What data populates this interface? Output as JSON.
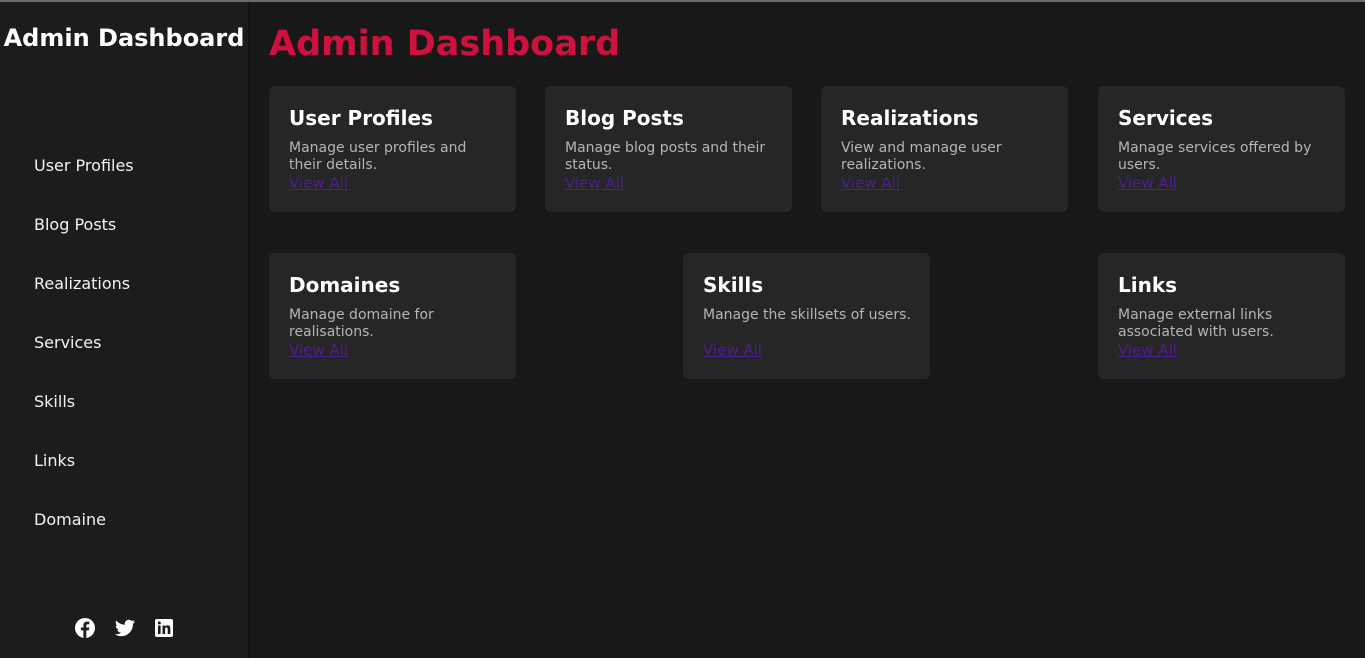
{
  "sidebar": {
    "title": "Admin Dashboard",
    "items": [
      {
        "label": "User Profiles"
      },
      {
        "label": "Blog Posts"
      },
      {
        "label": "Realizations"
      },
      {
        "label": "Services"
      },
      {
        "label": "Skills"
      },
      {
        "label": "Links"
      },
      {
        "label": "Domaine"
      }
    ],
    "social": [
      "facebook-icon",
      "twitter-icon",
      "linkedin-icon"
    ]
  },
  "main": {
    "title": "Admin Dashboard",
    "cards": [
      {
        "title": "User Profiles",
        "description": "Manage user profiles and their details.",
        "link": "View All"
      },
      {
        "title": "Blog Posts",
        "description": "Manage blog posts and their status.",
        "link": "View All"
      },
      {
        "title": "Realizations",
        "description": "View and manage user realizations.",
        "link": "View All"
      },
      {
        "title": "Services",
        "description": "Manage services offered by users.",
        "link": "View All"
      },
      {
        "title": "Domaines",
        "description": "Manage domaine for realisations.",
        "link": "View All"
      },
      {
        "title": "Skills",
        "description": "Manage the skillsets of users.",
        "link": "View All"
      },
      {
        "title": "Links",
        "description": "Manage external links associated with users.",
        "link": "View All"
      }
    ]
  },
  "colors": {
    "accent": "#d0103e",
    "link": "#4c1e8f",
    "background": "#181818",
    "sidebar": "#1c1c1c",
    "card": "#262626"
  }
}
